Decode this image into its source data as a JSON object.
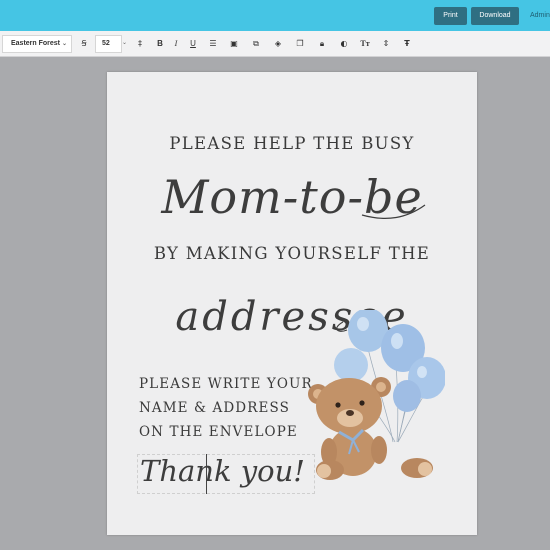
{
  "topbar": {
    "print_label": "Print",
    "download_label": "Download",
    "admin_label": "Admin",
    "color": "#45c5e4"
  },
  "toolbar": {
    "font_family": "Eastern Forest",
    "font_size": "52",
    "icons": [
      "font-style-icon",
      "text-height-icon",
      "bold-icon",
      "italic-icon",
      "underline-icon",
      "align-icon",
      "image-icon",
      "duplicate-icon",
      "layers-icon",
      "copy-icon",
      "lock-icon",
      "color-icon",
      "text-case-icon",
      "line-spacing-icon",
      "text-spacing-icon"
    ]
  },
  "page": {
    "line1": "PLEASE HELP THE BUSY",
    "script1": "Mom-to-be",
    "line3": "BY MAKING YOURSELF THE",
    "script2": "addressee",
    "small1": "PLEASE WRITE YOUR",
    "small2": "NAME & ADDRESS",
    "small3": "ON THE ENVELOPE",
    "thanks": "Thank you!",
    "illustration": "teddy-bear-with-blue-balloons"
  }
}
